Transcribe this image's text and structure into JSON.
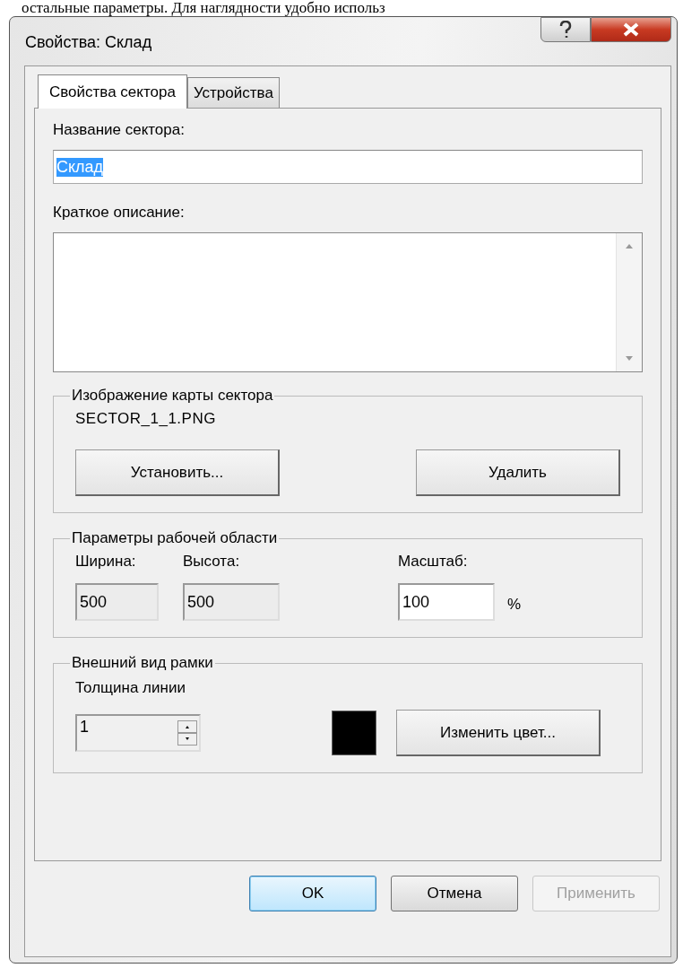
{
  "doc_text": "остальные параметры. Для наглядности удобно использ",
  "window": {
    "title": "Свойства: Склад"
  },
  "tabs": [
    {
      "label": "Свойства сектора",
      "selected": true
    },
    {
      "label": "Устройства",
      "selected": false
    }
  ],
  "sector_name": {
    "label": "Название сектора:",
    "value": "Склад",
    "value_selected": true
  },
  "description": {
    "label": "Краткое описание:"
  },
  "map_image": {
    "title": "Изображение карты сектора",
    "file": "SECTOR_1_1.PNG",
    "buttons": [
      "Установить...",
      "Удалить"
    ]
  },
  "work_area": {
    "title": "Параметры рабочей области",
    "fields": [
      {
        "label": "Ширина:",
        "value": "500",
        "disabled": true
      },
      {
        "label": "Высота:",
        "value": "500",
        "disabled": true
      },
      {
        "label": "Масштаб:",
        "value": "100",
        "disabled": false,
        "unit": "%"
      }
    ]
  },
  "frame": {
    "title": "Внешний вид рамки",
    "thickness": {
      "label": "Толщина линии",
      "value": "1"
    },
    "color": "#000000",
    "change_button": "Изменить цвет..."
  },
  "buttons": [
    {
      "label": "OK",
      "default": true,
      "disabled": false
    },
    {
      "label": "Отмена",
      "default": false,
      "disabled": false
    },
    {
      "label": "Применить",
      "default": false,
      "disabled": true
    }
  ]
}
